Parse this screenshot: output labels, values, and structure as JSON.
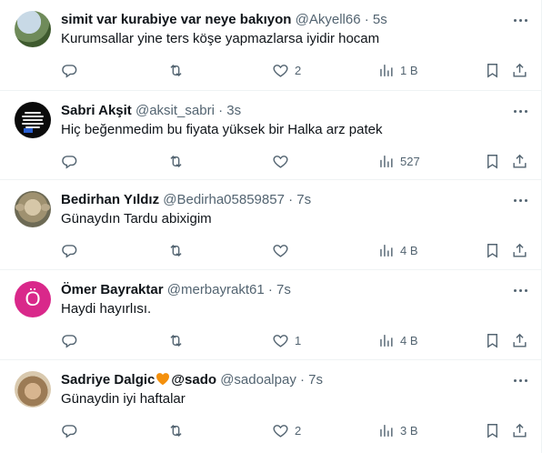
{
  "tweets": [
    {
      "name": "simit var kurabiye var neye bakıyon",
      "handle": "@Akyell66",
      "dot": "·",
      "time": "5s",
      "text": "Kurumsallar yine ters köşe yapmazlarsa iyidir hocam",
      "likes": "2",
      "views": "1 B"
    },
    {
      "name": "Sabri Akşit",
      "handle": "@aksit_sabri",
      "dot": "·",
      "time": "3s",
      "text": "Hiç beğenmedim bu fiyata yüksek bir Halka arz patek",
      "likes": "",
      "views": "527"
    },
    {
      "name": "Bedirhan Yıldız",
      "handle": "@Bedirha05859857",
      "dot": "·",
      "time": "7s",
      "text": "Günaydın Tardu abixigim",
      "likes": "",
      "views": "4 B"
    },
    {
      "name": "Ömer Bayraktar",
      "handle": "@merbayrakt61",
      "dot": "·",
      "time": "7s",
      "text": "Haydi hayırlısı.",
      "likes": "1",
      "views": "4 B",
      "avatar_letter": "Ö"
    },
    {
      "name_before": "Sadriye Dalgic",
      "name_after": "@sado",
      "handle": "@sadoalpay",
      "dot": "·",
      "time": "7s",
      "text": "Günaydin iyi haftalar",
      "likes": "2",
      "views": "3 B"
    }
  ],
  "colors": {
    "text_primary": "#0f1419",
    "text_secondary": "#536471",
    "divider": "#eff3f4",
    "heart_emoji": "#f4900c",
    "avatar_o_bg": "#d9288a"
  },
  "icons": [
    "reply-icon",
    "retweet-icon",
    "like-icon",
    "views-icon",
    "bookmark-icon",
    "share-icon",
    "more-icon"
  ]
}
